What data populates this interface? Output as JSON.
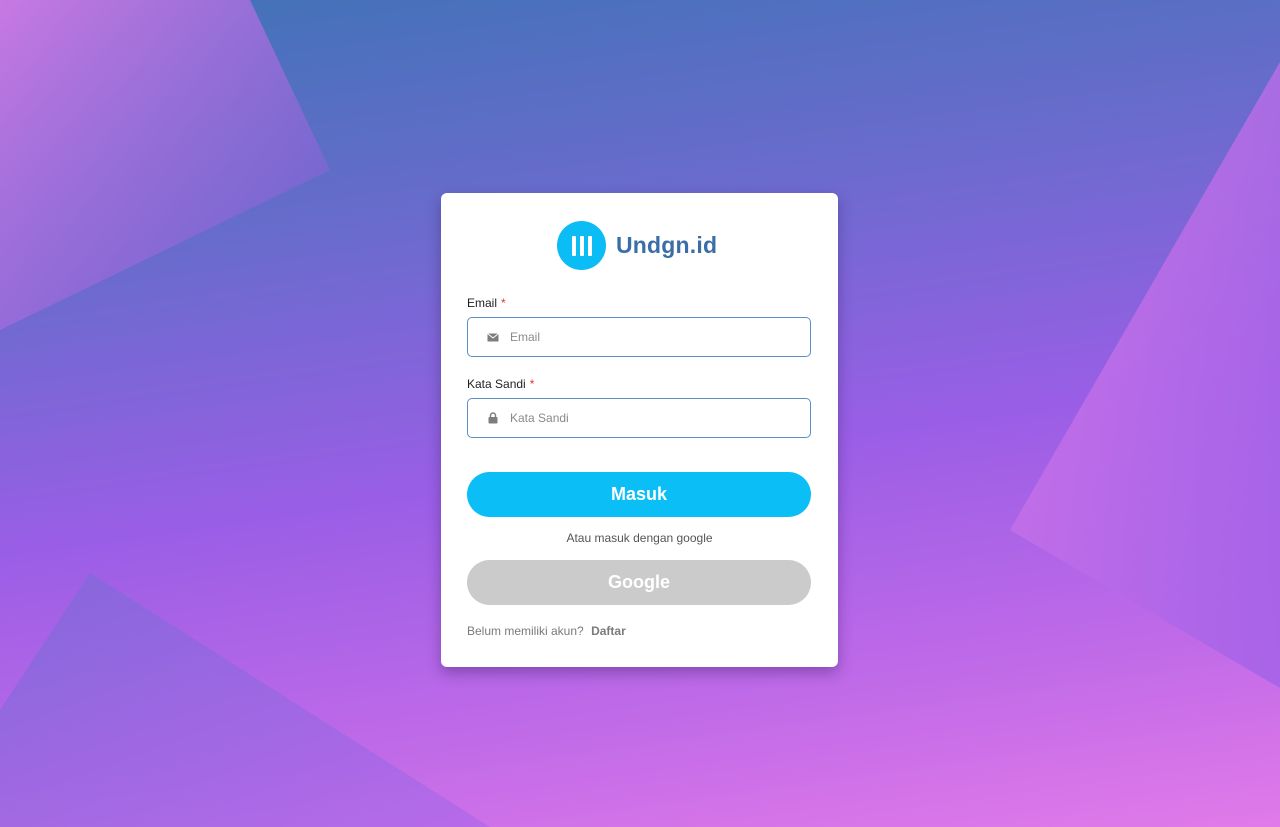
{
  "brand": {
    "name": "Undgn.id",
    "logo_color": "#0cbcf4",
    "name_color": "#3a6ea8"
  },
  "form": {
    "email": {
      "label": "Email",
      "required_mark": "*",
      "placeholder": "Email",
      "value": "",
      "icon": "envelope-icon"
    },
    "password": {
      "label": "Kata Sandi",
      "required_mark": "*",
      "placeholder": "Kata Sandi",
      "value": "",
      "icon": "lock-icon"
    },
    "submit_label": "Masuk",
    "divider_text": "Atau masuk dengan google",
    "google_label": "Google"
  },
  "footer": {
    "prompt": "Belum memiliki akun?",
    "register_link": "Daftar"
  },
  "colors": {
    "primary_button": "#0bbff6",
    "google_button": "#cbcbcb",
    "input_border": "#5b8fc4",
    "required": "#e5322d"
  }
}
